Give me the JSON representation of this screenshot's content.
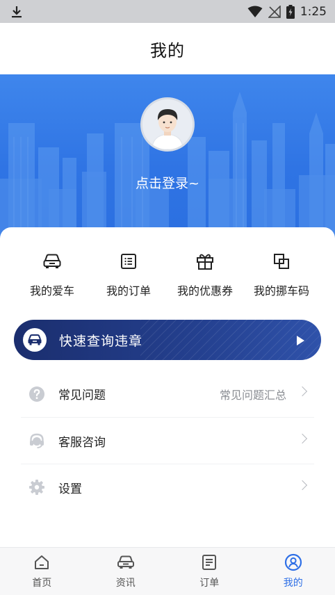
{
  "status_bar": {
    "time": "1:25",
    "icons": [
      "download-icon",
      "wifi-icon",
      "no-signal-icon",
      "battery-icon"
    ]
  },
  "header": {
    "title": "我的"
  },
  "profile": {
    "login_prompt": "点击登录~"
  },
  "quick_actions": [
    {
      "label": "我的爱车",
      "icon": "car-icon"
    },
    {
      "label": "我的订单",
      "icon": "order-list-icon"
    },
    {
      "label": "我的优惠券",
      "icon": "gift-icon"
    },
    {
      "label": "我的挪车码",
      "icon": "copy-squares-icon"
    }
  ],
  "violation_banner": {
    "label": "快速查询违章",
    "icon": "car-icon",
    "accent": "#1b2e6e"
  },
  "menu": [
    {
      "label": "常见问题",
      "value": "常见问题汇总",
      "icon": "question-icon"
    },
    {
      "label": "客服咨询",
      "value": "",
      "icon": "headset-icon"
    },
    {
      "label": "设置",
      "value": "",
      "icon": "gear-icon"
    }
  ],
  "tabs": [
    {
      "label": "首页",
      "icon": "home-icon",
      "active": false
    },
    {
      "label": "资讯",
      "icon": "car-front-icon",
      "active": false
    },
    {
      "label": "订单",
      "icon": "document-icon",
      "active": false
    },
    {
      "label": "我的",
      "icon": "user-circle-icon",
      "active": true
    }
  ],
  "colors": {
    "primary": "#2e6fe6",
    "hero": "#3a80ea",
    "banner": "#1b2e6e"
  }
}
